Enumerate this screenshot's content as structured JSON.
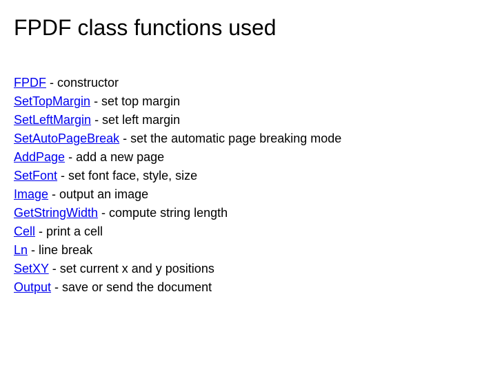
{
  "title": "FPDF class functions used",
  "functions": [
    {
      "name": "FPDF",
      "desc": " - constructor"
    },
    {
      "name": "SetTopMargin",
      "desc": " - set top margin"
    },
    {
      "name": "SetLeftMargin",
      "desc": " - set left margin"
    },
    {
      "name": "SetAutoPageBreak",
      "desc": " - set the automatic page breaking mode"
    },
    {
      "name": "AddPage",
      "desc": " - add a new page"
    },
    {
      "name": "SetFont",
      "desc": " - set font face, style, size"
    },
    {
      "name": "Image",
      "desc": " - output an image"
    },
    {
      "name": "GetStringWidth",
      "desc": " - compute string length"
    },
    {
      "name": "Cell",
      "desc": " - print a cell"
    },
    {
      "name": "Ln",
      "desc": " - line break"
    },
    {
      "name": "SetXY",
      "desc": " - set current x and y positions"
    },
    {
      "name": "Output",
      "desc": " - save or send the document"
    }
  ]
}
